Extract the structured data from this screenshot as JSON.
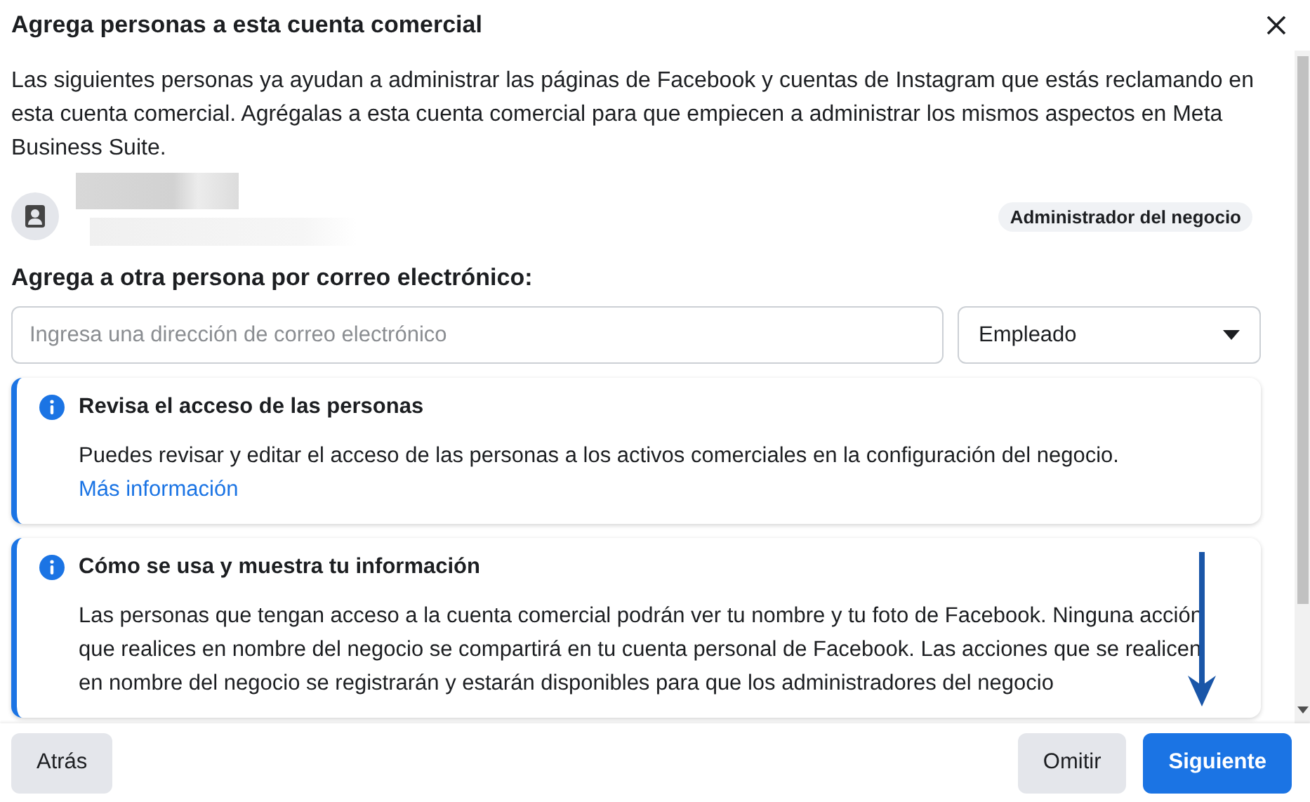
{
  "dialog": {
    "title": "Agrega personas a esta cuenta comercial"
  },
  "intro": "Las siguientes personas ya ayudan a administrar las páginas de Facebook y cuentas de Instagram que estás reclamando en esta cuenta comercial. Agrégalas a esta cuenta comercial para que empiecen a administrar los mismos aspectos en Meta Business Suite.",
  "person": {
    "role_badge": "Administrador del negocio"
  },
  "add_heading": "Agrega a otra persona por correo electrónico:",
  "email_field": {
    "placeholder": "Ingresa una dirección de correo electrónico"
  },
  "role_select": {
    "value": "Empleado"
  },
  "info_cards": [
    {
      "title": "Revisa el acceso de las personas",
      "body": "Puedes revisar y editar el acceso de las personas a los activos comerciales en la configuración del negocio.",
      "link": "Más información"
    },
    {
      "title": "Cómo se usa y muestra tu información",
      "body": "Las personas que tengan acceso a la cuenta comercial podrán ver tu nombre y tu foto de Facebook. Ninguna acción que realices en nombre del negocio se compartirá en tu cuenta personal de Facebook. Las acciones que se realicen en nombre del negocio se registrarán y estarán disponibles para que los administradores del negocio"
    }
  ],
  "footer": {
    "buttons": [
      {
        "label": "Atrás",
        "kind": "secondary"
      },
      {
        "label": "Omitir",
        "kind": "secondary"
      },
      {
        "label": "Siguiente",
        "kind": "primary"
      }
    ]
  }
}
